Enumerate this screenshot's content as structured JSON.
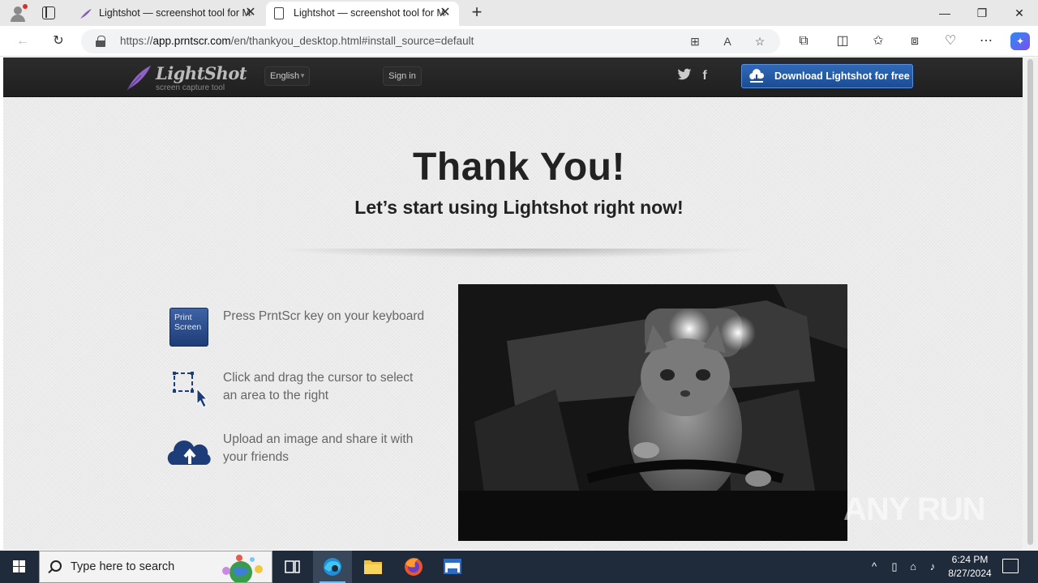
{
  "browser": {
    "tabs": [
      {
        "title": "Lightshot — screenshot tool for Mac & Win",
        "active": false
      },
      {
        "title": "Lightshot — screenshot tool for Mac & Win",
        "active": true
      }
    ],
    "url_prefix": "https://",
    "url_domain": "app.prntscr.com",
    "url_path": "/en/thankyou_desktop.html#install_source=default"
  },
  "site": {
    "logo_name": "LightShot",
    "logo_tagline": "screen capture tool",
    "language": "English",
    "signin_label": "Sign in",
    "download_label": "Download Lightshot for free",
    "accent_color": "#1b4c94"
  },
  "hero": {
    "title": "Thank You!",
    "subtitle": "Let’s start using Lightshot right now!"
  },
  "steps": [
    {
      "icon": "print-screen-key-icon",
      "key_label_1": "Print",
      "key_label_2": "Screen",
      "text": "Press PrntScr key on your keyboard"
    },
    {
      "icon": "select-area-icon",
      "text": "Click and drag the cursor to select an area to the right"
    },
    {
      "icon": "cloud-upload-icon",
      "text": "Upload an image and share it with your friends"
    }
  ],
  "watermark": "ANY RUN",
  "taskbar": {
    "search_placeholder": "Type here to search",
    "time": "6:24 PM",
    "date": "8/27/2024"
  }
}
